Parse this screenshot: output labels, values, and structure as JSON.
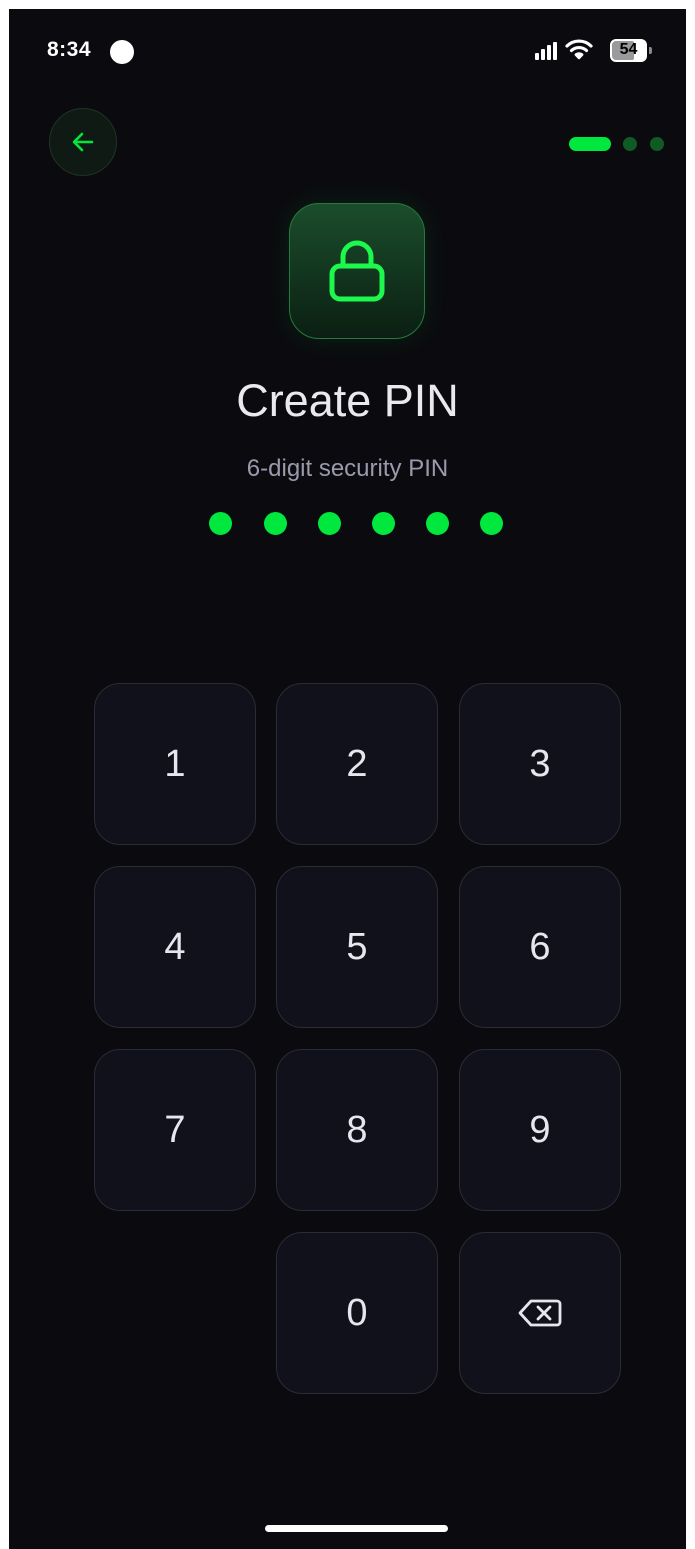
{
  "status_bar": {
    "time": "8:34",
    "battery_level": "54",
    "signal_icon": "cellular-signal-icon",
    "wifi_icon": "wifi-icon"
  },
  "header": {
    "back_icon": "arrow-left-icon",
    "steps_total": 3,
    "step_current": 1
  },
  "hero": {
    "icon": "lock-icon",
    "title": "Create PIN",
    "subtitle": "6-digit security PIN"
  },
  "pin": {
    "length": 6,
    "filled": 6
  },
  "keypad": {
    "keys": [
      "1",
      "2",
      "3",
      "4",
      "5",
      "6",
      "7",
      "8",
      "9",
      "0"
    ],
    "delete_icon": "backspace-icon"
  },
  "colors": {
    "accent": "#00e83d",
    "background": "#0b0b0f",
    "key_background": "#10111a",
    "step_inactive": "#0e5b25",
    "subtitle": "#9a9aac"
  }
}
